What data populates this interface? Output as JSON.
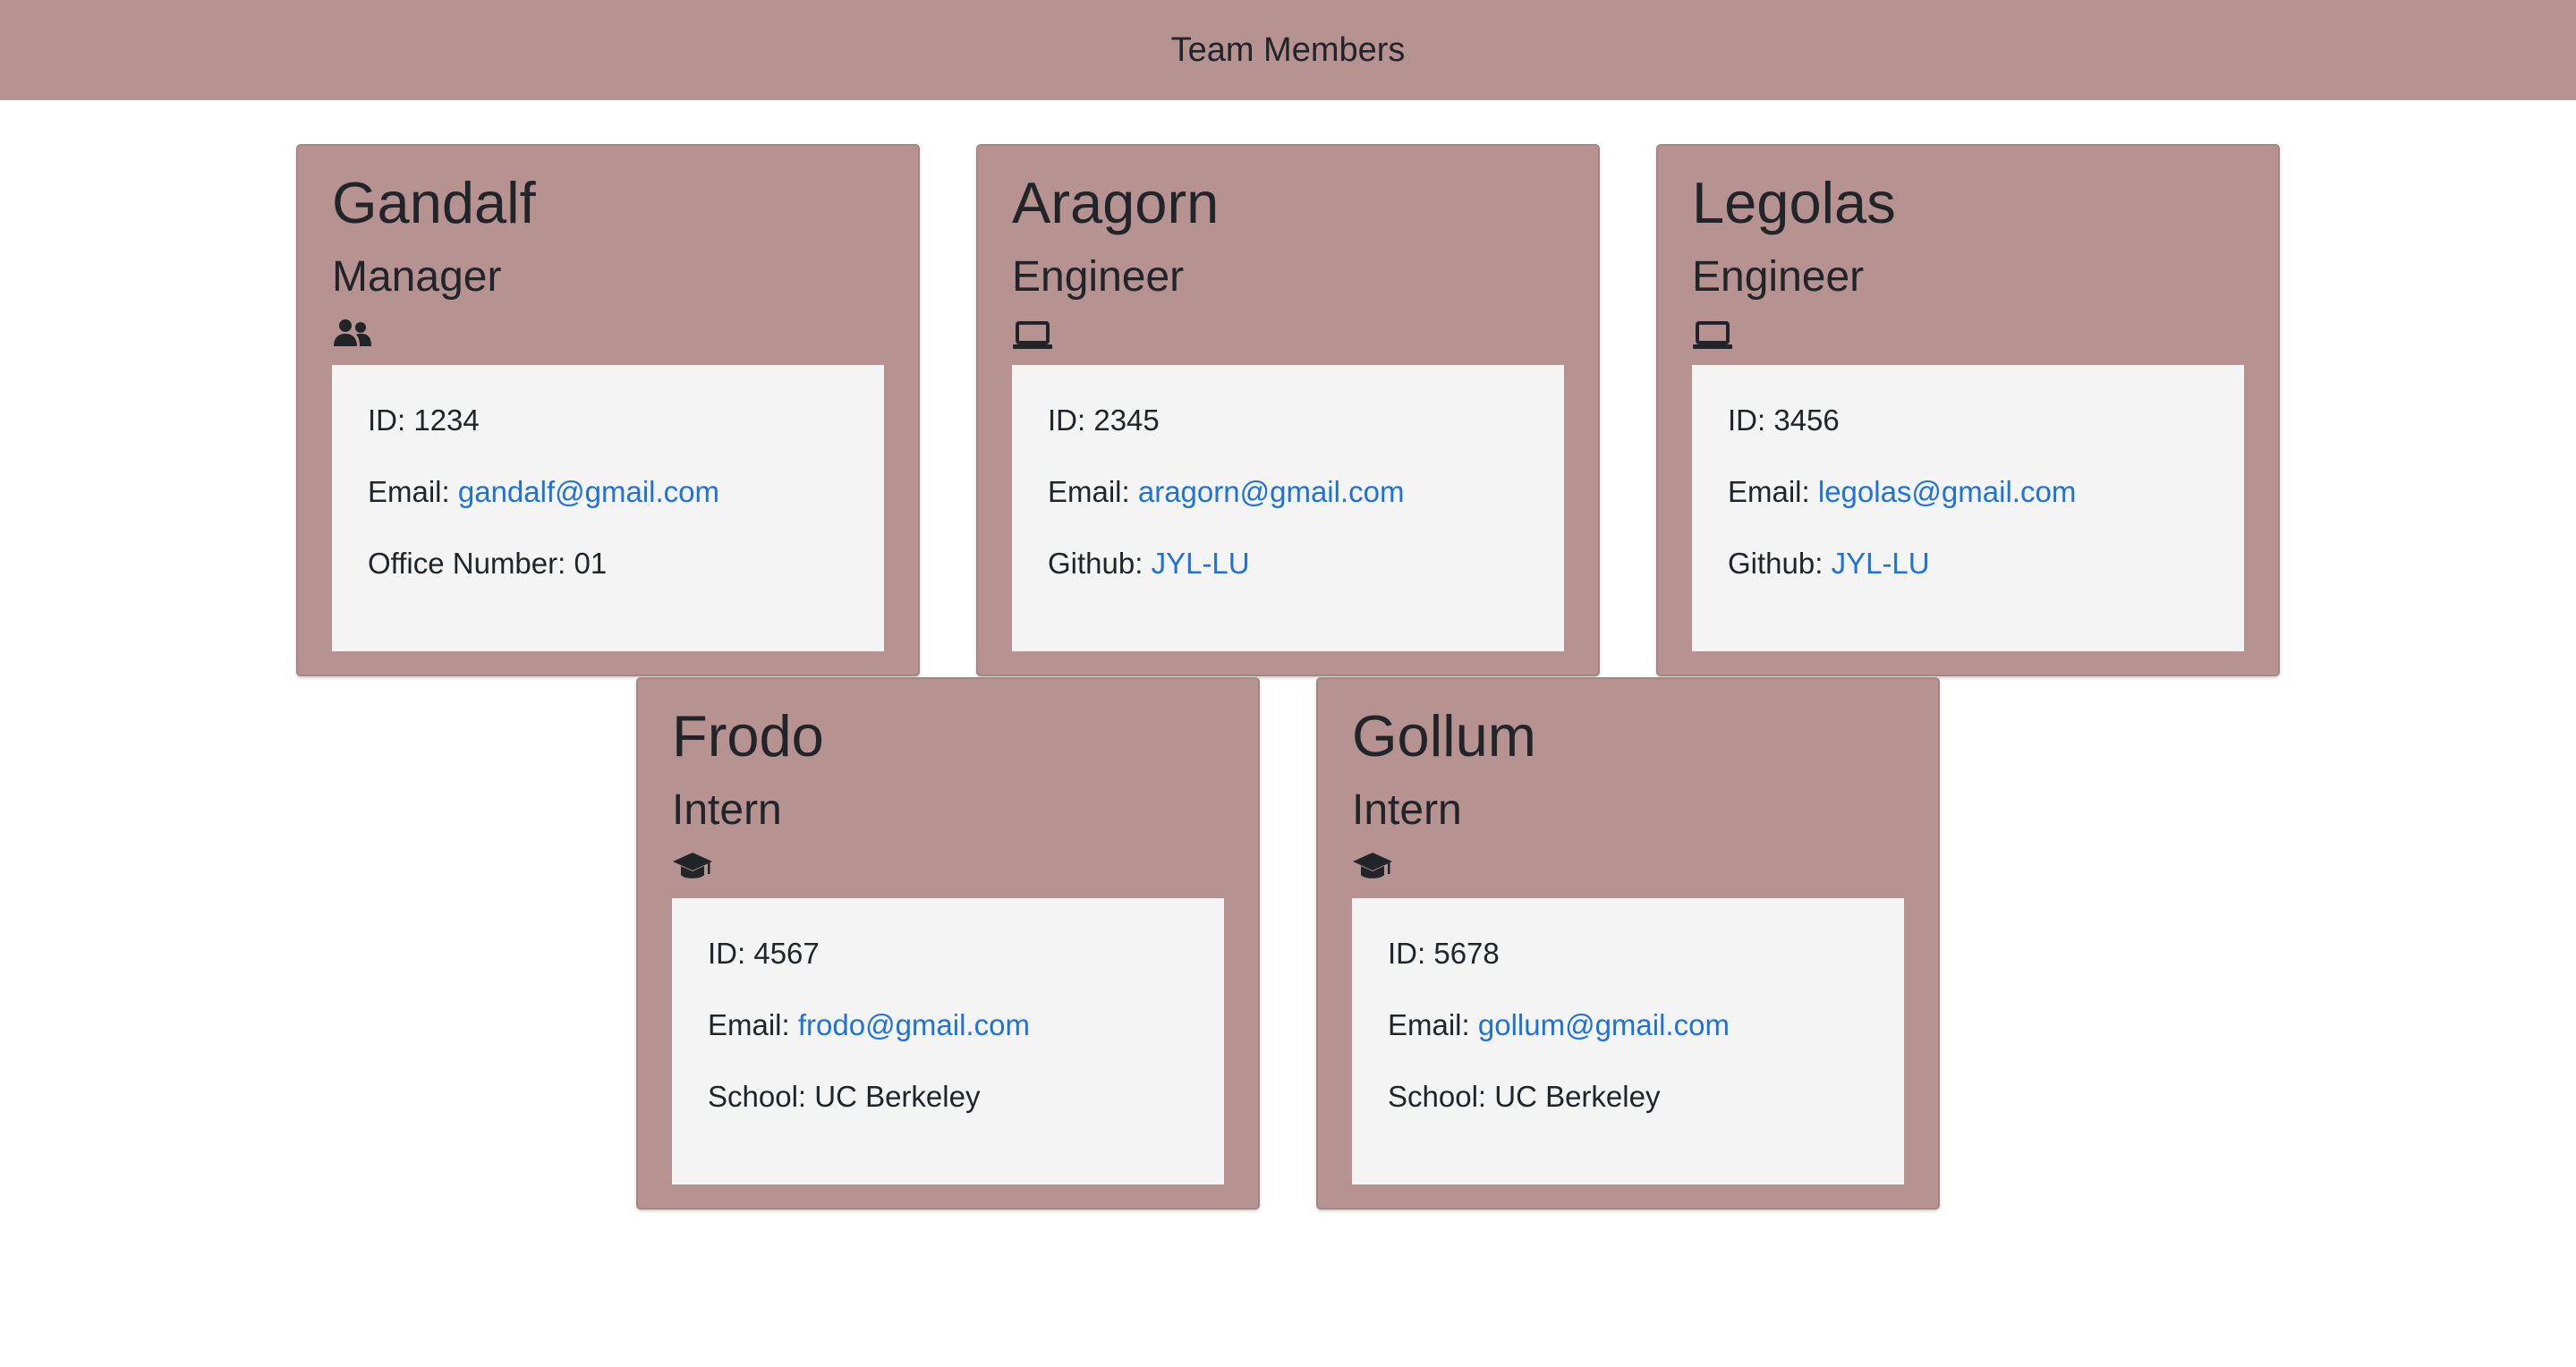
{
  "header": {
    "title": "Team Members"
  },
  "cards": [
    {
      "name": "Gandalf",
      "role": "Manager",
      "icon": "users-icon",
      "id_label": "ID: 1234",
      "email_label": "Email:",
      "email": "gandalf@gmail.com",
      "extra_label": "Office Number: 01",
      "extra_link": ""
    },
    {
      "name": "Aragorn",
      "role": "Engineer",
      "icon": "laptop-icon",
      "id_label": "ID: 2345",
      "email_label": "Email:",
      "email": "aragorn@gmail.com",
      "extra_label": "Github:",
      "extra_link": "JYL-LU"
    },
    {
      "name": "Legolas",
      "role": "Engineer",
      "icon": "laptop-icon",
      "id_label": "ID: 3456",
      "email_label": "Email:",
      "email": "legolas@gmail.com",
      "extra_label": "Github:",
      "extra_link": "JYL-LU"
    },
    {
      "name": "Frodo",
      "role": "Intern",
      "icon": "graduation-cap-icon",
      "id_label": "ID: 4567",
      "email_label": "Email:",
      "email": "frodo@gmail.com",
      "extra_label": "School: UC Berkeley",
      "extra_link": ""
    },
    {
      "name": "Gollum",
      "role": "Intern",
      "icon": "graduation-cap-icon",
      "id_label": "ID: 5678",
      "email_label": "Email:",
      "email": "gollum@gmail.com",
      "extra_label": "School: UC Berkeley",
      "extra_link": ""
    }
  ],
  "colors": {
    "card_background": "#b69290",
    "details_background": "#f4f4f4",
    "link": "#1f72d9",
    "text": "#212529"
  }
}
